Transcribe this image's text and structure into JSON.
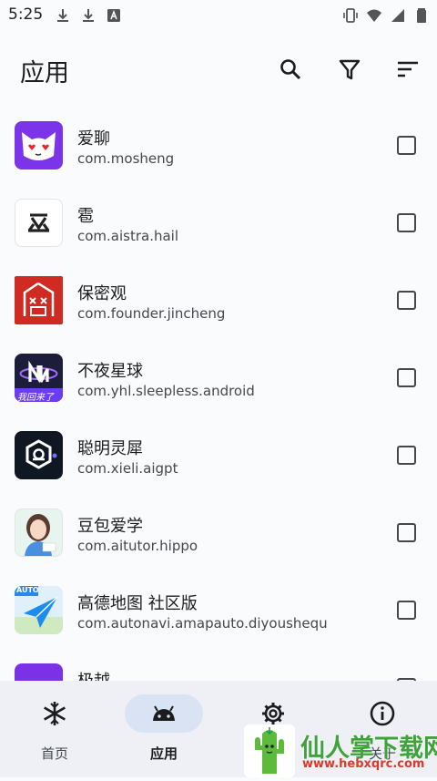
{
  "status_bar": {
    "time": "5:25",
    "left_icons": [
      "download-icon",
      "download-icon",
      "a-box-icon"
    ],
    "right_icons": [
      "vibrate-icon",
      "wifi-icon",
      "signal-icon",
      "battery-icon"
    ]
  },
  "header": {
    "title": "应用",
    "actions": [
      "search-icon",
      "filter-icon",
      "sort-icon"
    ]
  },
  "apps": [
    {
      "name": "爱聊",
      "package": "com.mosheng",
      "checked": false
    },
    {
      "name": "雹",
      "package": "com.aistra.hail",
      "checked": false
    },
    {
      "name": "保密观",
      "package": "com.founder.jincheng",
      "checked": false
    },
    {
      "name": "不夜星球",
      "package": "com.yhl.sleepless.android",
      "checked": false,
      "icon_text": "我回来了"
    },
    {
      "name": "聪明灵犀",
      "package": "com.xieli.aigpt",
      "checked": false
    },
    {
      "name": "豆包爱学",
      "package": "com.aitutor.hippo",
      "checked": false
    },
    {
      "name": "高德地图 社区版",
      "package": "com.autonavi.amapauto.diyoushequ",
      "checked": false,
      "icon_text": "AUTO"
    },
    {
      "name": "极越",
      "package": "",
      "checked": false
    }
  ],
  "bottom_nav": [
    {
      "label": "首页",
      "icon": "snowflake-icon",
      "active": false
    },
    {
      "label": "应用",
      "icon": "android-icon",
      "active": true
    },
    {
      "label": "",
      "icon": "gear-icon",
      "active": false
    },
    {
      "label": "关于",
      "icon": "info-icon",
      "active": false
    }
  ],
  "watermark": {
    "text": "仙人掌下载网",
    "url": "www.hebxqrc.com"
  },
  "colors": {
    "background": "#fafbfd",
    "nav_background": "#eef0f5",
    "active_pill": "#d9e3f3"
  }
}
